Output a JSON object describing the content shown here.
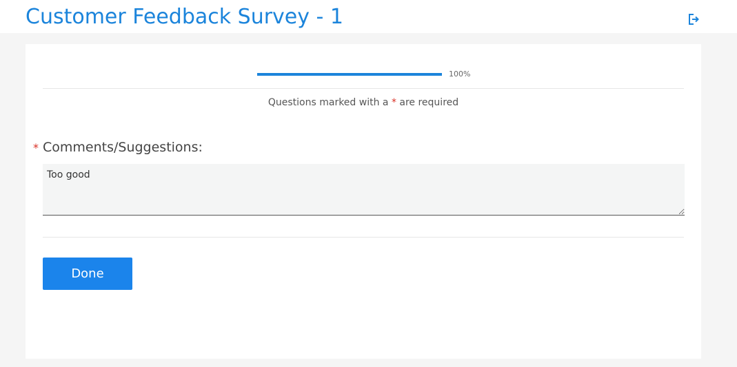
{
  "header": {
    "title": "Customer Feedback Survey - 1",
    "logout_icon": "logout-icon"
  },
  "progress": {
    "percent": 100,
    "label": "100%"
  },
  "notice": {
    "prefix": "Questions marked with a ",
    "star": "*",
    "suffix": " are required"
  },
  "question": {
    "required_star": "*",
    "label": "Comments/Suggestions:",
    "answer": "Too good"
  },
  "actions": {
    "done_label": "Done"
  },
  "colors": {
    "accent": "#1b84db",
    "button": "#1b84eb",
    "required": "#d93025",
    "background": "#f5f5f5"
  }
}
